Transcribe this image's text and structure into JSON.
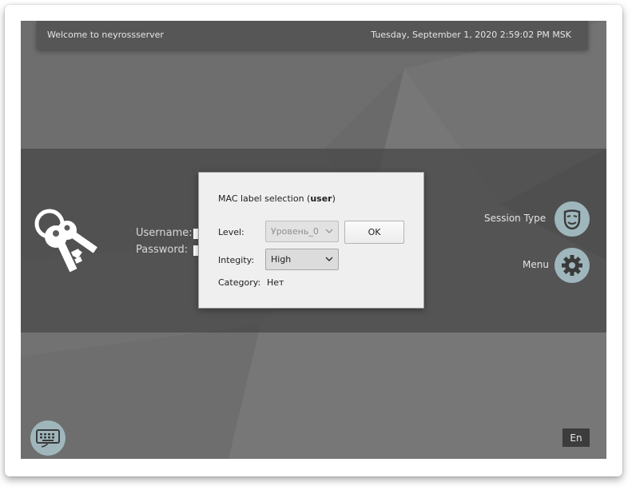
{
  "topbar": {
    "welcome": "Welcome to neyrossserver",
    "datetime": "Tuesday, September 1, 2020 2:59:02 PM MSK"
  },
  "login": {
    "username_label": "Username:",
    "password_label": "Password:"
  },
  "session": {
    "label": "Session Type",
    "icon": "theater-mask-icon"
  },
  "menu": {
    "label": "Menu",
    "icon": "gear-icon"
  },
  "keyboard": {
    "icon": "keyboard-icon"
  },
  "language": {
    "label": "En"
  },
  "dialog": {
    "title_prefix": "MAC label selection (",
    "title_user": "user",
    "title_suffix": ")",
    "level_label": "Level:",
    "level_value": "Уровень_0",
    "integrity_label": "Integity:",
    "integrity_value": "High",
    "category_label": "Category:",
    "category_value": "Нет",
    "ok_label": "OK"
  },
  "colors": {
    "background": "#6e6e6e",
    "band": "#464646",
    "icon_circle": "#9fb7bc",
    "dialog": "#efefef"
  }
}
